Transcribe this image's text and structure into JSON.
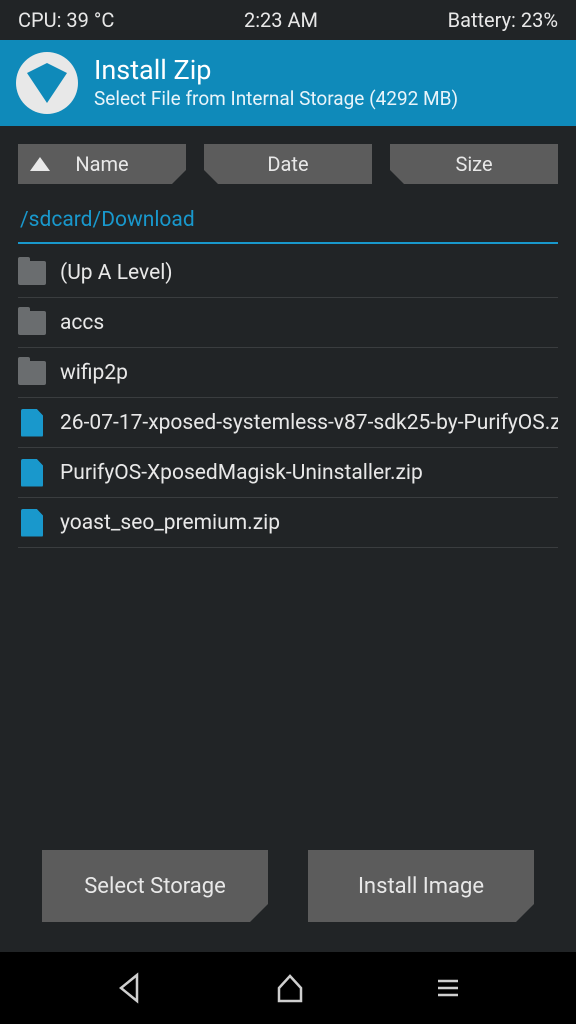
{
  "status": {
    "cpu": "CPU: 39 °C",
    "time": "2:23 AM",
    "battery": "Battery: 23%"
  },
  "header": {
    "title": "Install Zip",
    "subtitle": "Select File from Internal Storage (4292 MB)"
  },
  "sort": {
    "name": "Name",
    "date": "Date",
    "size": "Size"
  },
  "path": "/sdcard/Download",
  "files": {
    "up": "(Up A Level)",
    "f0": "accs",
    "f1": "wifip2p",
    "z0": "26-07-17-xposed-systemless-v87-sdk25-by-PurifyOS.z",
    "z1": "PurifyOS-XposedMagisk-Uninstaller.zip",
    "z2": "yoast_seo_premium.zip"
  },
  "buttons": {
    "storage": "Select Storage",
    "image": "Install Image"
  }
}
